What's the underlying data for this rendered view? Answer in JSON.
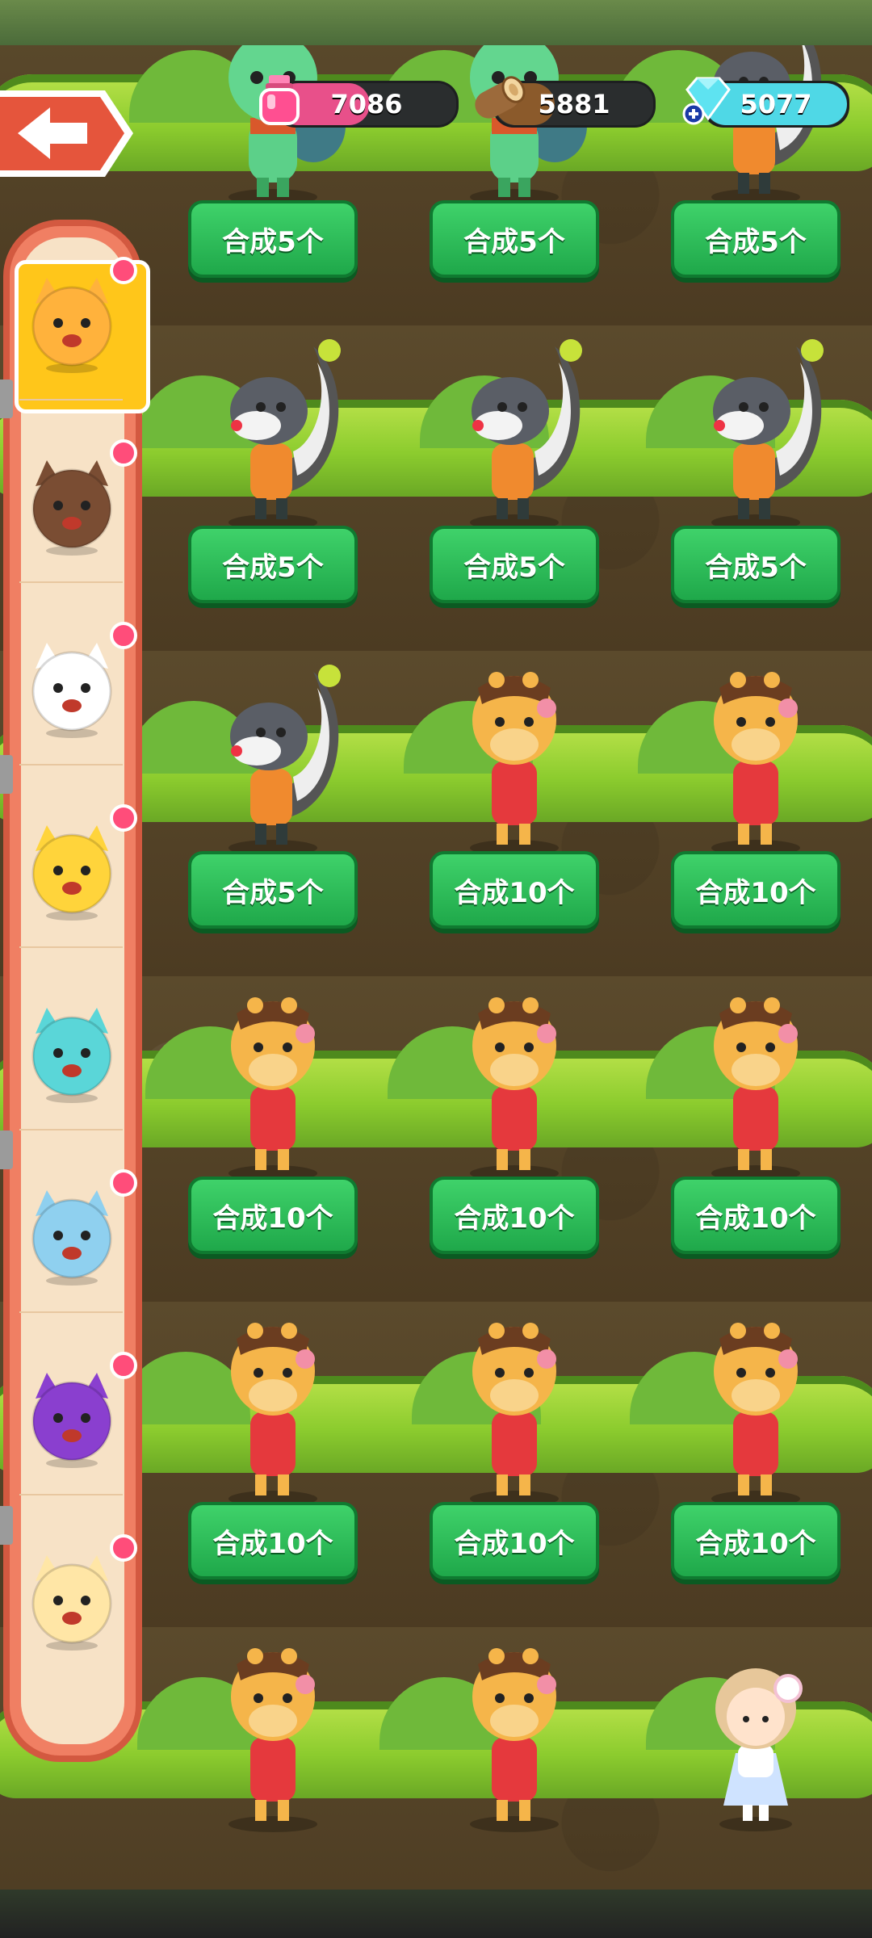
{
  "resources": {
    "potion": {
      "value": "7086",
      "fill_fraction": 0.52,
      "color": "#e8508a",
      "icon": "potion-bottle-icon"
    },
    "wood": {
      "value": "5881",
      "fill_fraction": 0.38,
      "color": "#8b5a2b",
      "icon": "wood-log-icon"
    },
    "gems": {
      "value": "5077",
      "fill_fraction": 1.0,
      "color": "#4fd8e6",
      "icon": "diamond-plus-icon"
    }
  },
  "back_button": {
    "icon": "arrow-left-icon"
  },
  "sidebar": {
    "selected_index": 0,
    "items": [
      {
        "character": "orange-cat",
        "color": "#ffb23c",
        "badge": true
      },
      {
        "character": "brown-bear",
        "color": "#7a4d33",
        "badge": true
      },
      {
        "character": "white-rabbit",
        "color": "#ffffff",
        "badge": true
      },
      {
        "character": "yellow-blue-chick",
        "color": "#ffd43b",
        "badge": true
      },
      {
        "character": "cyan-jelly",
        "color": "#5ad6d8",
        "badge": false
      },
      {
        "character": "blue-cat",
        "color": "#8fd0ef",
        "badge": true
      },
      {
        "character": "purple-bird",
        "color": "#8a3fcf",
        "badge": true
      },
      {
        "character": "yellow-cow",
        "color": "#ffe6a6",
        "badge": true
      }
    ]
  },
  "grid": {
    "rows": [
      {
        "cells": [
          {
            "animal": "green-lion",
            "button": "合成5个"
          },
          {
            "animal": "green-lion",
            "button": "合成5个"
          },
          {
            "animal": "skunk",
            "button": "合成5个"
          }
        ]
      },
      {
        "cells": [
          {
            "animal": "skunk",
            "button": "合成5个"
          },
          {
            "animal": "skunk",
            "button": "合成5个"
          },
          {
            "animal": "skunk",
            "button": "合成5个"
          }
        ]
      },
      {
        "cells": [
          {
            "animal": "skunk",
            "button": "合成5个"
          },
          {
            "animal": "giraffe",
            "button": "合成10个"
          },
          {
            "animal": "giraffe",
            "button": "合成10个"
          }
        ]
      },
      {
        "cells": [
          {
            "animal": "giraffe",
            "button": "合成10个"
          },
          {
            "animal": "giraffe",
            "button": "合成10个"
          },
          {
            "animal": "giraffe",
            "button": "合成10个"
          }
        ]
      },
      {
        "cells": [
          {
            "animal": "giraffe",
            "button": "合成10个"
          },
          {
            "animal": "giraffe",
            "button": "合成10个"
          },
          {
            "animal": "giraffe",
            "button": "合成10个"
          }
        ]
      },
      {
        "cells": [
          {
            "animal": "giraffe",
            "button": ""
          },
          {
            "animal": "giraffe",
            "button": ""
          },
          {
            "animal": "girl-with-flower",
            "button": ""
          }
        ]
      }
    ]
  }
}
